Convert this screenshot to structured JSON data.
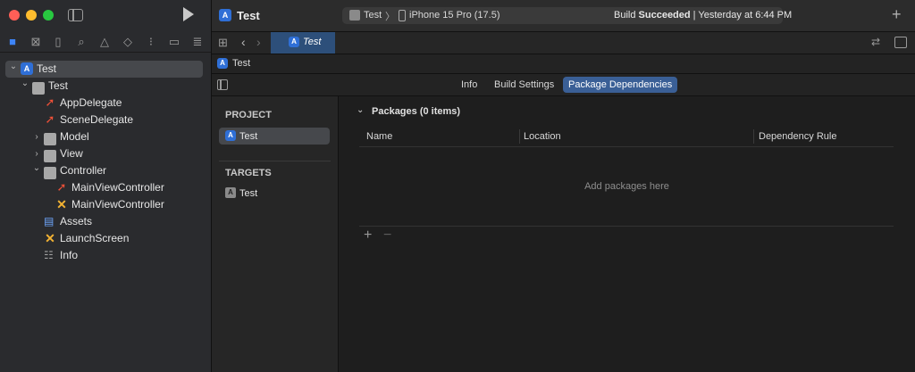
{
  "sidebar": {
    "navigator_icons": [
      "folder-icon",
      "source-control-icon",
      "bookmark-icon",
      "find-icon",
      "issue-icon",
      "test-icon",
      "debug-icon",
      "breakpoint-icon",
      "report-icon"
    ],
    "tree": [
      {
        "label": "Test",
        "kind": "project",
        "indent": 0,
        "arrow": "down"
      },
      {
        "label": "Test",
        "kind": "folder",
        "indent": 1,
        "arrow": "down"
      },
      {
        "label": "AppDelegate",
        "kind": "swift",
        "indent": 2,
        "arrow": ""
      },
      {
        "label": "SceneDelegate",
        "kind": "swift",
        "indent": 2,
        "arrow": ""
      },
      {
        "label": "Model",
        "kind": "folder",
        "indent": 2,
        "arrow": "right"
      },
      {
        "label": "View",
        "kind": "folder",
        "indent": 2,
        "arrow": "right"
      },
      {
        "label": "Controller",
        "kind": "folder",
        "indent": 2,
        "arrow": "down"
      },
      {
        "label": "MainViewController",
        "kind": "swift",
        "indent": 3,
        "arrow": ""
      },
      {
        "label": "MainViewController",
        "kind": "xib",
        "indent": 3,
        "arrow": ""
      },
      {
        "label": "Assets",
        "kind": "assets",
        "indent": 2,
        "arrow": ""
      },
      {
        "label": "LaunchScreen",
        "kind": "xib",
        "indent": 2,
        "arrow": ""
      },
      {
        "label": "Info",
        "kind": "plist",
        "indent": 2,
        "arrow": ""
      }
    ]
  },
  "toolbar": {
    "project_title": "Test",
    "scheme": "Test",
    "device": "iPhone 15 Pro (17.5)",
    "status_prefix": "Build ",
    "status_bold": "Succeeded",
    "status_suffix": " | Yesterday at 6:44 PM",
    "add_label": "+"
  },
  "tabbar": {
    "active_tab": "Test"
  },
  "breadcrumb": {
    "label": "Test"
  },
  "editor_tabs": [
    "Info",
    "Build Settings",
    "Package Dependencies"
  ],
  "targets_panel": {
    "project_header": "PROJECT",
    "project_item": "Test",
    "targets_header": "TARGETS",
    "target_item": "Test"
  },
  "packages": {
    "title": "Packages (0 items)",
    "columns": [
      "Name",
      "Location",
      "Dependency Rule"
    ],
    "empty_text": "Add packages here",
    "add_label": "+",
    "remove_label": "−"
  },
  "colors": {
    "accent": "#3a5f96",
    "sidebar_bg": "#2a2b2e",
    "editor_bg": "#1e1e1e"
  }
}
